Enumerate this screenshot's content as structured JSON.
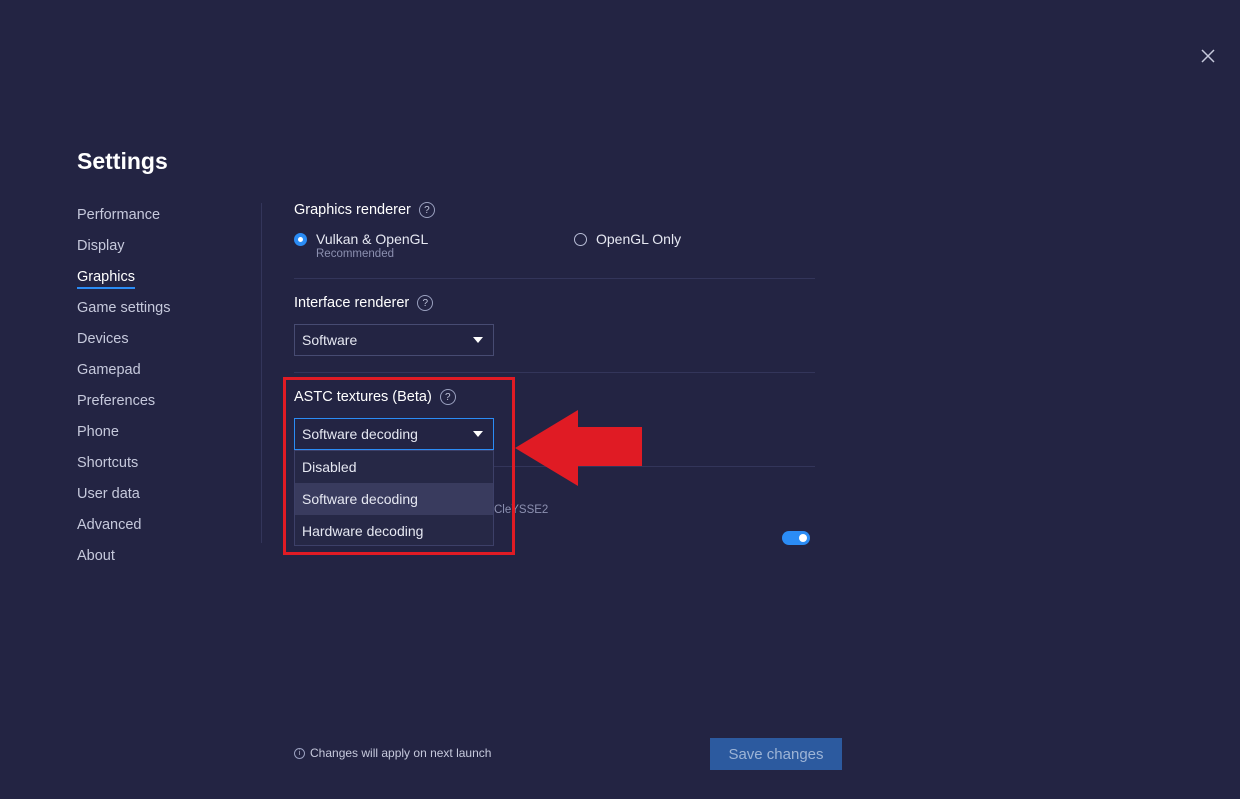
{
  "window": {
    "title": "Settings",
    "close_icon": "close-icon"
  },
  "sidebar": {
    "items": [
      {
        "label": "Performance"
      },
      {
        "label": "Display"
      },
      {
        "label": "Graphics",
        "active": true
      },
      {
        "label": "Game settings"
      },
      {
        "label": "Devices"
      },
      {
        "label": "Gamepad"
      },
      {
        "label": "Preferences"
      },
      {
        "label": "Phone"
      },
      {
        "label": "Shortcuts"
      },
      {
        "label": "User data"
      },
      {
        "label": "Advanced"
      },
      {
        "label": "About"
      }
    ]
  },
  "graphics_renderer": {
    "label": "Graphics renderer",
    "help": "?",
    "options": [
      {
        "label": "Vulkan & OpenGL",
        "sublabel": "Recommended",
        "checked": true
      },
      {
        "label": "OpenGL Only",
        "checked": false
      }
    ]
  },
  "interface_renderer": {
    "label": "Interface renderer",
    "help": "?",
    "value": "Software"
  },
  "astc": {
    "label": "ASTC textures (Beta)",
    "help": "?",
    "value": "Software decoding",
    "options": [
      "Disabled",
      "Software decoding",
      "Hardware decoding"
    ],
    "highlighted": "Software decoding"
  },
  "obscured_text": "CleYSSE2",
  "footer": {
    "note": "Changes will apply on next launch",
    "info_icon": "i",
    "save_label": "Save changes"
  },
  "colors": {
    "background": "#232443",
    "accent": "#2b8cf5",
    "annotation_red": "#e01b24",
    "save_button": "#2c5a9f"
  }
}
